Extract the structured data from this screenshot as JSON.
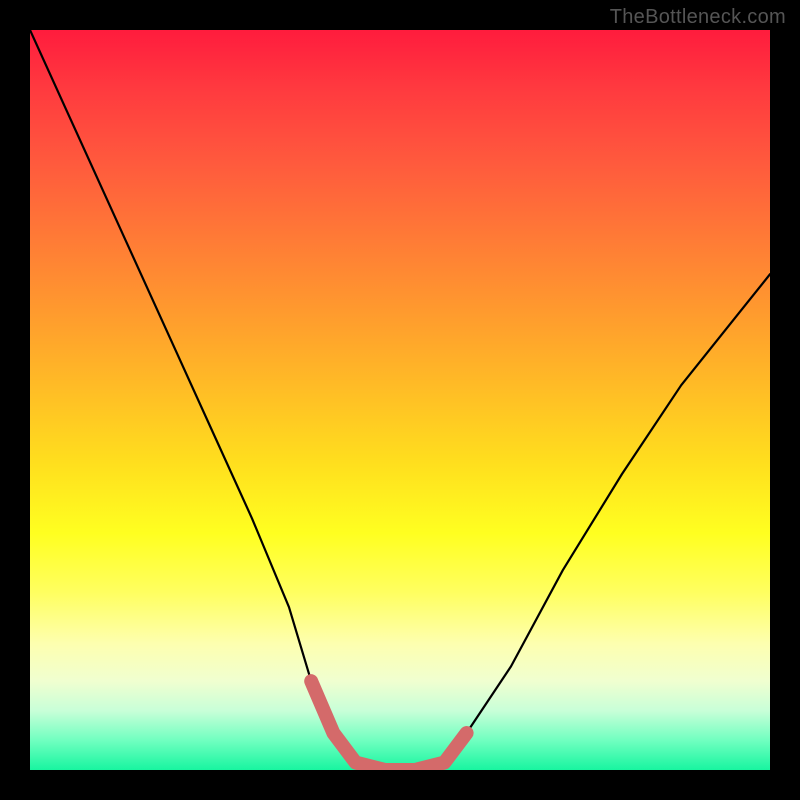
{
  "watermark": "TheBottleneck.com",
  "chart_data": {
    "type": "line",
    "title": "",
    "xlabel": "",
    "ylabel": "",
    "xlim": [
      0,
      100
    ],
    "ylim": [
      0,
      100
    ],
    "grid": false,
    "series": [
      {
        "name": "curve",
        "color": "#000000",
        "x": [
          0,
          5,
          10,
          15,
          20,
          25,
          30,
          35,
          38,
          41,
          44,
          48,
          52,
          56,
          59,
          65,
          72,
          80,
          88,
          96,
          100
        ],
        "y": [
          100,
          89,
          78,
          67,
          56,
          45,
          34,
          22,
          12,
          5,
          1,
          0,
          0,
          1,
          5,
          14,
          27,
          40,
          52,
          62,
          67
        ]
      },
      {
        "name": "highlight",
        "color": "#d46a6a",
        "x": [
          38,
          41,
          44,
          48,
          52,
          56,
          59
        ],
        "y": [
          12,
          5,
          1,
          0,
          0,
          1,
          5
        ]
      }
    ],
    "gradient_stops": [
      {
        "pos": 0,
        "color": "#ff1c3d"
      },
      {
        "pos": 18,
        "color": "#ff5a3d"
      },
      {
        "pos": 38,
        "color": "#ff9a2e"
      },
      {
        "pos": 58,
        "color": "#ffdd1e"
      },
      {
        "pos": 76,
        "color": "#ffff60"
      },
      {
        "pos": 88,
        "color": "#f0ffd0"
      },
      {
        "pos": 100,
        "color": "#18f5a0"
      }
    ]
  }
}
